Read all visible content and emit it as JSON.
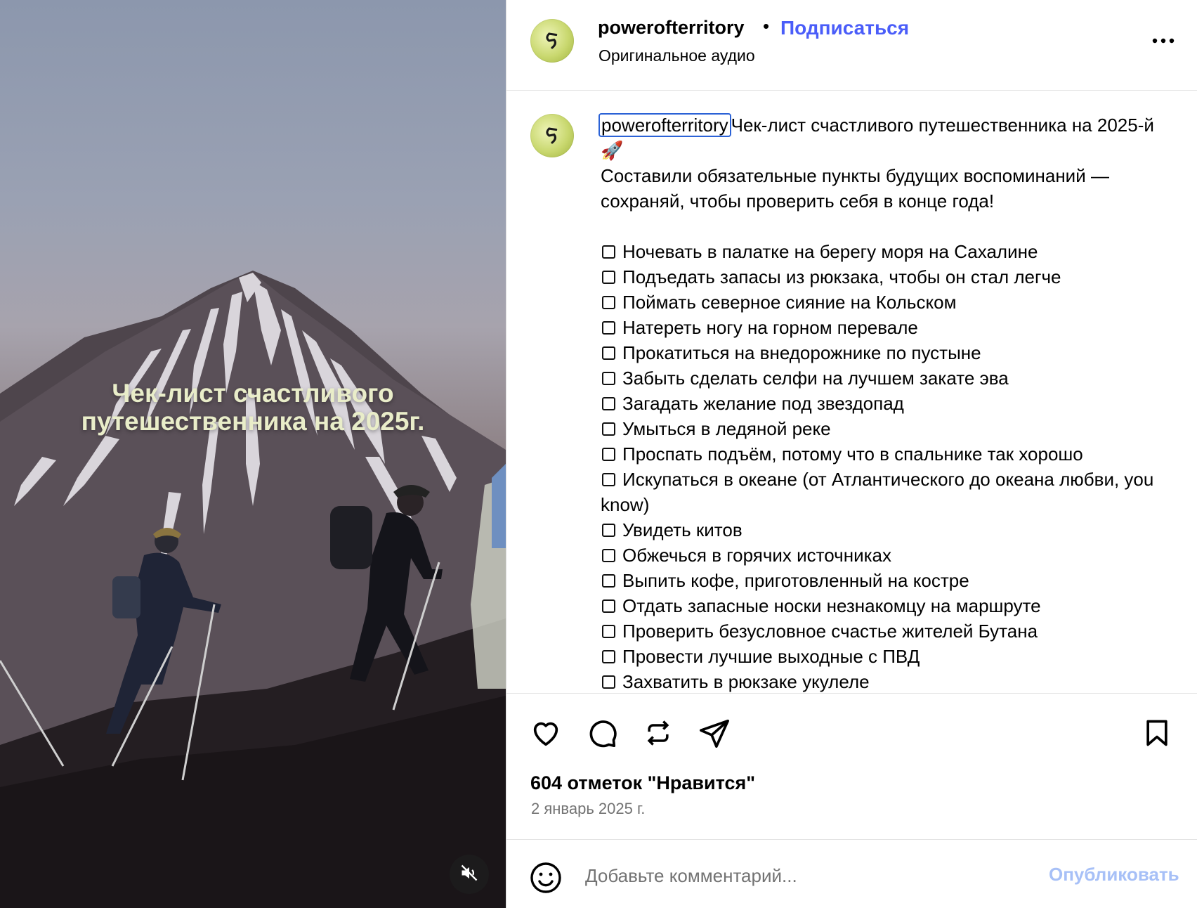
{
  "media": {
    "overlay_title_line1": "Чек-лист счастливого",
    "overlay_title_line2": "путешественника на 2025г.",
    "mute_icon": "speaker-muted-icon"
  },
  "header": {
    "username": "powerofterritory",
    "separator": "•",
    "follow_label": "Подписаться",
    "audio_label": "Оригинальное аудио",
    "more_icon": "more-horizontal-icon"
  },
  "caption": {
    "username": "powerofterritory",
    "title": "Чек-лист счастливого путешественника на 2025-й 🚀",
    "intro": "Составили обязательные пункты будущих воспоминаний — сохраняй, чтобы проверить себя в конце года!",
    "items": [
      "Ночевать в палатке на берегу моря на Сахалине",
      "Подъедать запасы из рюкзака, чтобы он стал легче",
      "Поймать северное сияние на Кольском",
      "Натереть ногу на горном перевале",
      "Прокатиться на внедорожнике по пустыне",
      "Забыть сделать селфи на лучшем закате эва",
      "Загадать желание под звездопад",
      "Умыться в ледяной реке",
      "Проспать подъём, потому что в спальнике так хорошо",
      "Искупаться в океане (от Атлантического до океана любви, you know)",
      "Увидеть китов",
      "Обжечься в горячих источниках",
      "Выпить кофе, приготовленный на костре",
      "Отдать запасные носки незнакомцу на маршруте",
      "Проверить безусловное счастье жителей Бутана",
      "Провести лучшие выходные с ПВД",
      "Захватить в рюкзаке укулеле"
    ]
  },
  "actions": {
    "like_icon": "heart-icon",
    "comment_icon": "comment-icon",
    "repost_icon": "repost-icon",
    "share_icon": "send-icon",
    "save_icon": "bookmark-icon"
  },
  "stats": {
    "likes_text": "604 отметок \"Нравится\"",
    "date_text": "2 январь 2025 г."
  },
  "comment": {
    "emoji_icon": "emoji-icon",
    "placeholder": "Добавьте комментарий...",
    "value": "",
    "publish_label": "Опубликовать",
    "publish_color": "#a7c0f7"
  },
  "colors": {
    "accent": "#4a5df9",
    "secondary_text": "#737373",
    "highlight_border": "#2b62d6"
  }
}
